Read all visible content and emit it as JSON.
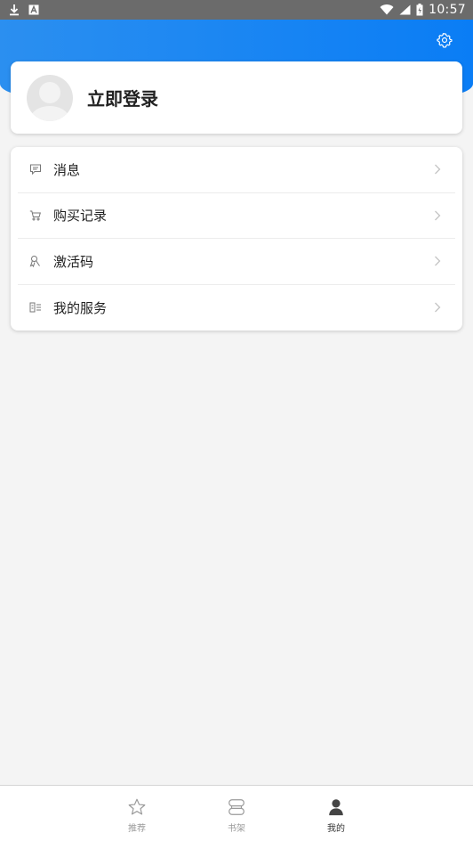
{
  "status_bar": {
    "time": "10:57",
    "left_icons": [
      "download-icon",
      "app-a-icon"
    ],
    "right_icons": [
      "wifi-icon",
      "signal-icon",
      "battery-icon"
    ]
  },
  "header": {
    "gradient_colors": [
      "#2b8ff0",
      "#0a7df5"
    ],
    "settings_icon": "gear-icon"
  },
  "login": {
    "label": "立即登录"
  },
  "menu": {
    "items": [
      {
        "label": "消息",
        "icon": "message-icon"
      },
      {
        "label": "购买记录",
        "icon": "cart-icon"
      },
      {
        "label": "激活码",
        "icon": "key-icon"
      },
      {
        "label": "我的服务",
        "icon": "service-icon"
      }
    ]
  },
  "bottom_nav": {
    "items": [
      {
        "label": "推荐",
        "icon": "star-icon",
        "active": false
      },
      {
        "label": "书架",
        "icon": "bookshelf-icon",
        "active": false
      },
      {
        "label": "我的",
        "icon": "person-icon",
        "active": true
      }
    ]
  }
}
